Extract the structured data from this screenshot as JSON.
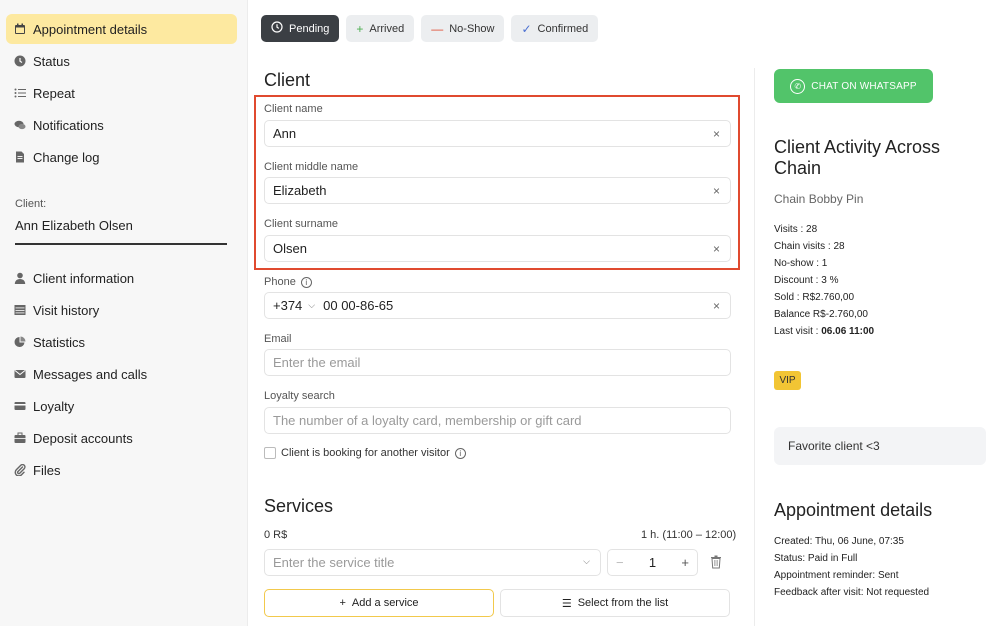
{
  "sidebar": {
    "items_top": [
      {
        "label": "Appointment details",
        "icon": "calendar-icon",
        "active": true
      },
      {
        "label": "Status",
        "icon": "clock-icon"
      },
      {
        "label": "Repeat",
        "icon": "list-icon"
      },
      {
        "label": "Notifications",
        "icon": "chat-bubbles-icon"
      },
      {
        "label": "Change log",
        "icon": "document-icon"
      }
    ],
    "client_caption": "Client:",
    "client_name": "Ann  Elizabeth Olsen",
    "items_bottom": [
      {
        "label": "Client information",
        "icon": "person-icon"
      },
      {
        "label": "Visit history",
        "icon": "table-icon"
      },
      {
        "label": "Statistics",
        "icon": "pie-chart-icon"
      },
      {
        "label": "Messages and calls",
        "icon": "envelope-icon"
      },
      {
        "label": "Loyalty",
        "icon": "card-icon"
      },
      {
        "label": "Deposit accounts",
        "icon": "briefcase-icon"
      },
      {
        "label": "Files",
        "icon": "paperclip-icon"
      }
    ]
  },
  "status_bar": {
    "pending": "Pending",
    "arrived": "Arrived",
    "no_show": "No-Show",
    "confirmed": "Confirmed"
  },
  "client_form": {
    "title": "Client",
    "name_label": "Client name",
    "name_value": "Ann",
    "middle_label": "Client middle name",
    "middle_value": "Elizabeth",
    "surname_label": "Client surname",
    "surname_value": "Olsen",
    "phone_label": "Phone",
    "phone_code": "+374",
    "phone_value": "00 00-86-65",
    "email_label": "Email",
    "email_placeholder": "Enter the email",
    "loyalty_label": "Loyalty search",
    "loyalty_placeholder": "The number of a loyalty card, membership or gift card",
    "another_visitor": "Client is booking for another visitor"
  },
  "services": {
    "title": "Services",
    "price": "0 R$",
    "time": "1 h. (11:00 – 12:00)",
    "service_placeholder": "Enter the service title",
    "quantity": "1",
    "add_label": "Add a service",
    "select_label": "Select from the list"
  },
  "right_panel": {
    "whatsapp_label": "CHAT ON WHATSAPP",
    "activity_title_1": "Client Activity Across",
    "activity_title_2": "Chain",
    "chain_name": "Chain Bobby Pin",
    "visits": "Visits : 28",
    "chain_visits": "Chain visits : 28",
    "no_show": "No-show : 1",
    "discount": "Discount : 3 %",
    "sold": "Sold : R$2.760,00",
    "balance": "Balance R$-2.760,00",
    "last_visit_label": "Last visit : ",
    "last_visit_value": "06.06 11:00",
    "vip_badge": "VIP",
    "favorite": "Favorite client <3",
    "appt_title": "Appointment details",
    "created": "Created: Thu, 06 June, 07:35",
    "status": "Status: Paid in Full",
    "reminder": "Appointment reminder: Sent",
    "feedback": "Feedback after visit: Not requested"
  },
  "colors": {
    "accent_yellow": "#fde9a0",
    "highlight_red": "#e04a2f",
    "whatsapp_green": "#52c46a",
    "vip_yellow": "#f2c534"
  }
}
